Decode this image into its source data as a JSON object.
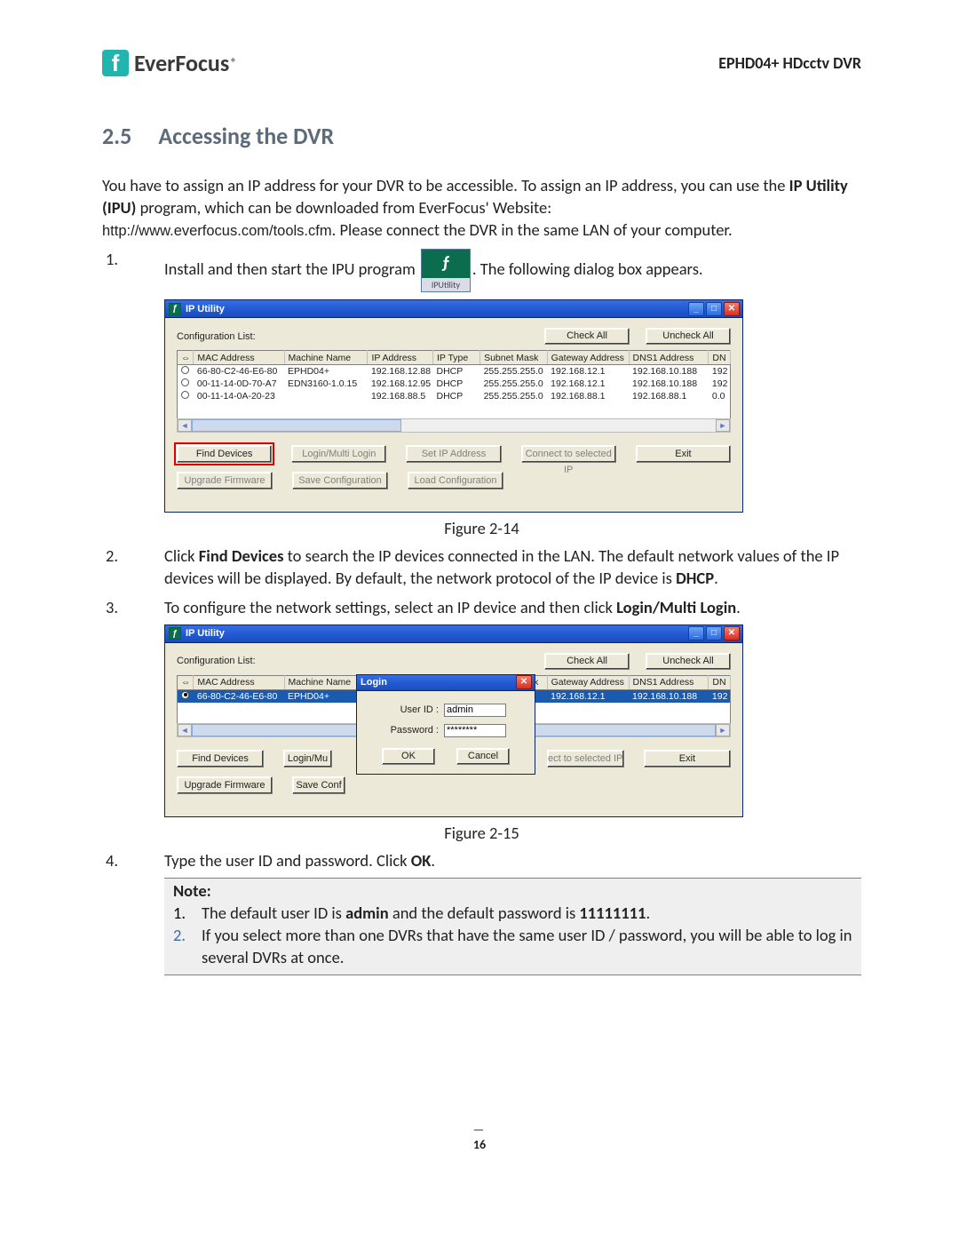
{
  "logo_text": "EverFocus",
  "doc_id": "EPHD04+  HDcctv DVR",
  "section_number": "2.5",
  "section_title": "Accessing the DVR",
  "intro_p1_a": "You have to assign an IP address for your DVR to be accessible. To assign an IP address, you can use the ",
  "intro_p1_bold": "IP Utility (IPU)",
  "intro_p1_b": " program, which can be downloaded from EverFocus' Website: ",
  "intro_link": "http://www.everfocus.com/tools.cfm",
  "intro_p1_c": ". Please connect the DVR in the same LAN of your computer.",
  "steps": {
    "s1a": "Install and then start the IPU program",
    "s1b": ". The following dialog box appears.",
    "s2a": "Click ",
    "s2bold": "Find Devices",
    "s2b": " to search the IP devices connected in the LAN. The default network values of the IP devices will be displayed. By default, the network protocol of the IP device is ",
    "s2bold2": "DHCP",
    "s2c": ".",
    "s3a": "To configure the network settings, select an IP device and then click ",
    "s3bold": "Login/Multi Login",
    "s3b": ".",
    "s4a": "Type the user ID and password. Click ",
    "s4bold": "OK",
    "s4b": "."
  },
  "ipu_icon_label": "IPUtility",
  "win": {
    "title": "IP Utility",
    "conf_label": "Configuration List:",
    "btn_check_all": "Check All",
    "btn_uncheck_all": "Uncheck All",
    "btn_find": "Find Devices",
    "btn_login": "Login/Multi Login",
    "btn_login_short": "Login/Mu",
    "btn_setip": "Set IP Address",
    "btn_connect": "Connect to selected IP",
    "btn_connect_short": "ect to selected IP",
    "btn_exit": "Exit",
    "btn_upgrade": "Upgrade Firmware",
    "btn_savecfg": "Save Configuration",
    "btn_savecfg_short": "Save Conf",
    "btn_loadcfg": "Load Configuration",
    "headers": [
      "",
      "MAC Address",
      "Machine Name",
      "IP Address",
      "IP Type",
      "Subnet Mask",
      "Gateway Address",
      "DNS1 Address",
      "DN"
    ],
    "rows": [
      [
        "66-80-C2-46-E6-80",
        "EPHD04+",
        "192.168.12.88",
        "DHCP",
        "255.255.255.0",
        "192.168.12.1",
        "192.168.10.188",
        "192"
      ],
      [
        "00-11-14-0D-70-A7",
        "EDN3160-1.0.15",
        "192.168.12.95",
        "DHCP",
        "255.255.255.0",
        "192.168.12.1",
        "192.168.10.188",
        "192"
      ],
      [
        "00-11-14-0A-20-23",
        "",
        "192.168.88.5",
        "DHCP",
        "255.255.255.0",
        "192.168.88.1",
        "192.168.88.1",
        "0.0"
      ]
    ]
  },
  "login": {
    "title": "Login",
    "user_label": "User ID :",
    "pass_label": "Password :",
    "user_value": "admin",
    "pass_value": "********",
    "ok": "OK",
    "cancel": "Cancel"
  },
  "fig1": "Figure 2-14",
  "fig2": "Figure 2-15",
  "note": {
    "title": "Note:",
    "n1a": "The default user ID is ",
    "n1b1": "admin",
    "n1b": " and the default password is ",
    "n1b2": "11111111",
    "n1c": ".",
    "n2": "If you select more than one DVRs that have the same user ID / password, you will be able to log in several DVRs at once."
  },
  "page_number": "16"
}
